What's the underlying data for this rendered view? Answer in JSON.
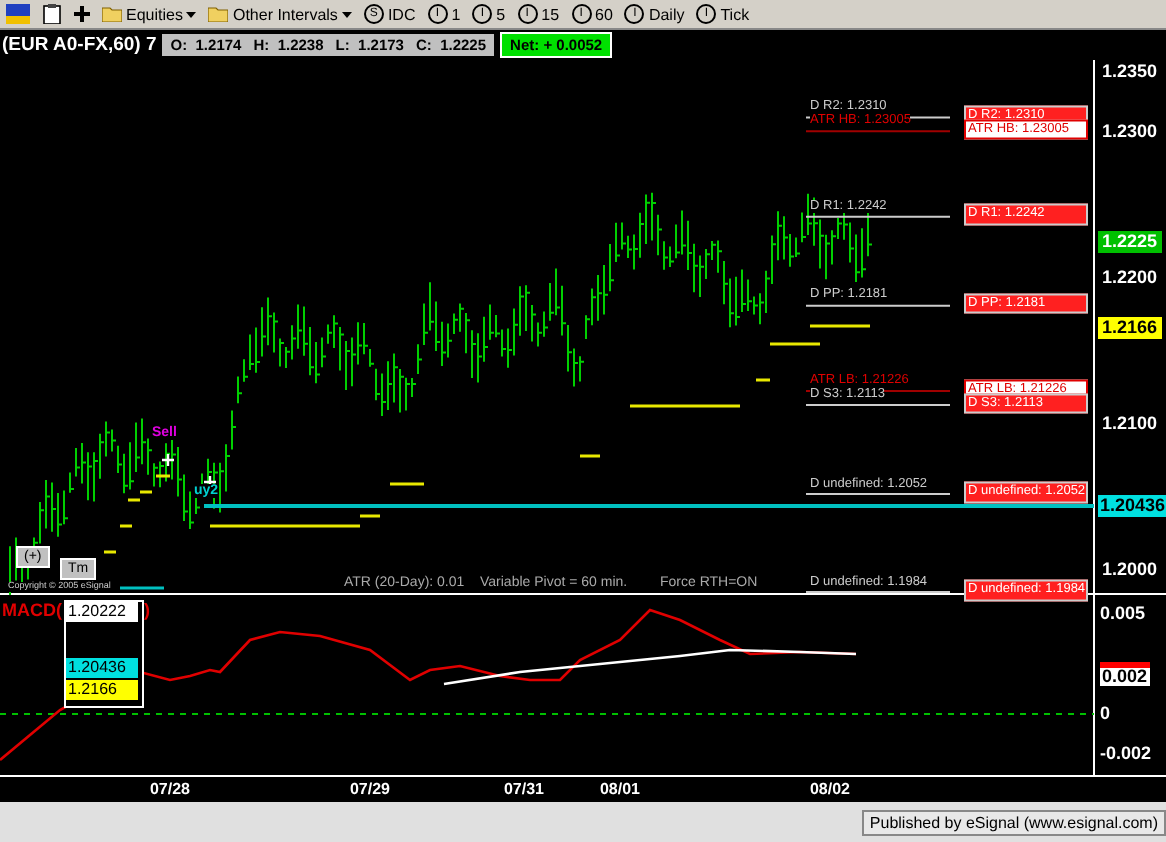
{
  "toolbar": {
    "items": [
      {
        "kind": "menu",
        "label": "Equities"
      },
      {
        "kind": "menu",
        "label": "Other Intervals"
      },
      {
        "kind": "interval",
        "symbol": "S",
        "label": "IDC"
      },
      {
        "kind": "interval",
        "symbol": "I",
        "label": "1"
      },
      {
        "kind": "interval",
        "symbol": "I",
        "label": "5"
      },
      {
        "kind": "interval",
        "symbol": "I",
        "label": "15"
      },
      {
        "kind": "interval",
        "symbol": "I",
        "label": "60"
      },
      {
        "kind": "interval",
        "symbol": "I",
        "label": "Daily"
      },
      {
        "kind": "interval",
        "symbol": "I",
        "label": "Tick"
      }
    ]
  },
  "quote": {
    "symbol": "(EUR A0-FX,60) 7",
    "fields": [
      {
        "label": "O:",
        "value": "1.2174"
      },
      {
        "label": "H:",
        "value": "1.2238"
      },
      {
        "label": "L:",
        "value": "1.2173"
      },
      {
        "label": "C:",
        "value": "1.2225"
      }
    ],
    "net": "Net: + 0.0052"
  },
  "price_axis": [
    {
      "text": "1.2350",
      "kind": "plain"
    },
    {
      "text": "1.2300",
      "kind": "plain"
    },
    {
      "text": "1.2225",
      "kind": "last"
    },
    {
      "text": "1.2200",
      "kind": "plain"
    },
    {
      "text": "1.2166",
      "kind": "yellow"
    },
    {
      "text": "1.2100",
      "kind": "plain"
    },
    {
      "text": "1.20436",
      "kind": "cyan"
    },
    {
      "text": "1.2000",
      "kind": "plain"
    }
  ],
  "levels": [
    {
      "kind": "pivot",
      "label": "D R2:  1.2310",
      "tag": "D R2:  1.2310"
    },
    {
      "kind": "atr",
      "label": "ATR HB: 1.23005",
      "tag": "ATR HB: 1.23005"
    },
    {
      "kind": "pivot",
      "label": "D R1:  1.2242",
      "tag": "D R1:  1.2242"
    },
    {
      "kind": "pivot",
      "label": "D PP:  1.2181",
      "tag": "D PP:  1.2181"
    },
    {
      "kind": "atr",
      "label": "ATR LB: 1.21226",
      "tag": "ATR LB: 1.21226"
    },
    {
      "kind": "pivot",
      "label": "D S3:  1.2113",
      "tag": "D S3:  1.2113"
    },
    {
      "kind": "pivot",
      "label": "D undefined:  1.2052",
      "tag": "D undefined:  1.2052"
    },
    {
      "kind": "pivot",
      "label": "D undefined:  1.1984",
      "tag": "D undefined:  1.1984"
    }
  ],
  "signals": [
    {
      "kind": "sell",
      "label": "Sell"
    },
    {
      "kind": "buy",
      "label": "uy2"
    }
  ],
  "chart_buttons": [
    "(+)",
    "Tm"
  ],
  "copyright": "Copyright © 2005 eSignal",
  "status": [
    "ATR (20-Day): 0.01",
    "Variable Pivot = 60 min.",
    "Force RTH=ON"
  ],
  "macd": {
    "title": "MACD(",
    "close": ")",
    "readouts": [
      {
        "kind": "white",
        "text": "1.20222"
      },
      {
        "kind": "cyan",
        "text": "1.20436"
      },
      {
        "kind": "yellow",
        "text": "1.2166"
      }
    ],
    "axis": [
      {
        "text": "0.005",
        "kind": "plain"
      },
      {
        "text": "0.002",
        "kind": "marker"
      },
      {
        "text": "0",
        "kind": "plain"
      },
      {
        "text": "-0.002",
        "kind": "plain"
      }
    ]
  },
  "dates": [
    "07/28",
    "07/29",
    "07/31",
    "08/01",
    "08/02"
  ],
  "footer": "Published by eSignal (www.esignal.com)"
}
